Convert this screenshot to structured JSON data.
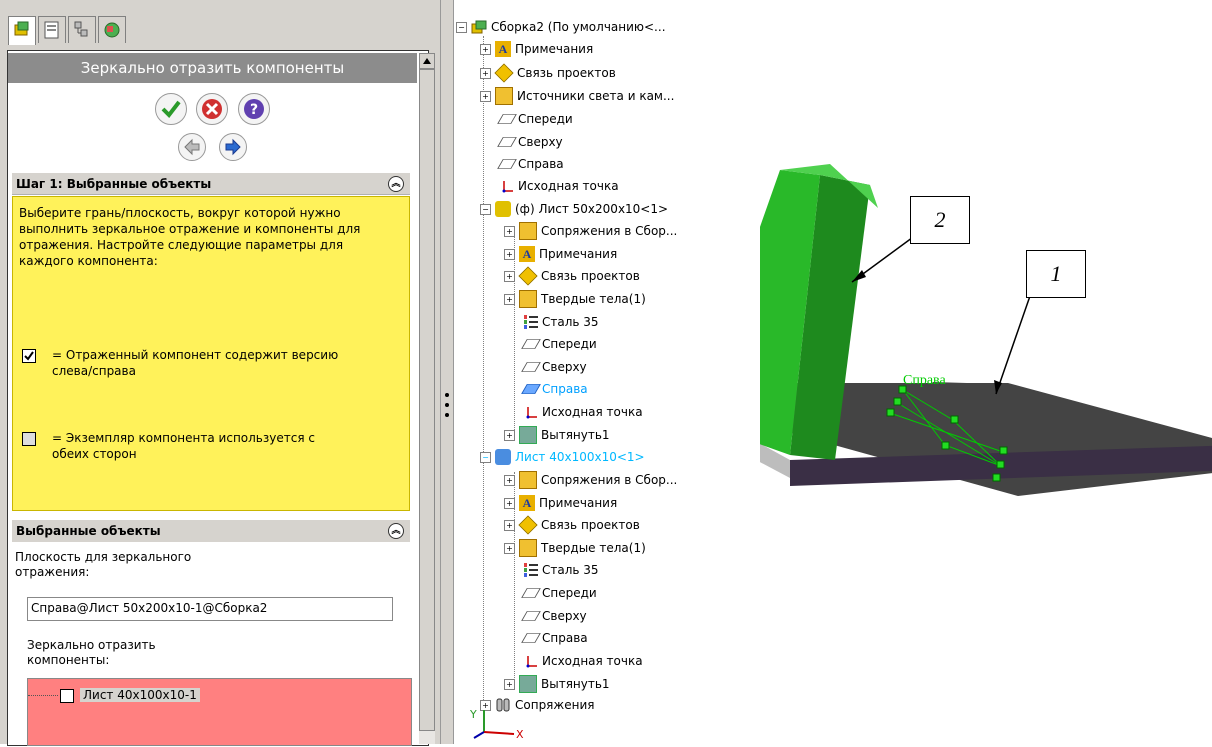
{
  "left_panel": {
    "title": "Зеркально отразить компоненты",
    "step1": {
      "header": "Шаг 1: Выбранные объекты",
      "description": "Выберите грань/плоскость, вокруг которой нужно выполнить зеркальное отражение и компоненты для отражения. Настройте следующие параметры для каждого компонента:",
      "legend_checked": "= Отраженный компонент содержит версию слева/справа",
      "legend_unchecked": "= Экземпляр компонента используется с обеих сторон"
    },
    "selections": {
      "header": "Выбранные объекты",
      "plane_label": "Плоскость для зеркального отражения:",
      "plane_value": "Справа@Лист 50х200х10-1@Сборка2",
      "components_label": "Зеркально отразить компоненты:",
      "components": [
        "Лист 40х100х10-1"
      ]
    },
    "colors": {
      "yellow": "#fff25a",
      "pink": "#ff8080"
    }
  },
  "tree": {
    "root": "Сборка2  (По умолчанию<...",
    "items": [
      "Примечания",
      "Связь проектов",
      "Источники света и кам...",
      "Спереди",
      "Сверху",
      "Справа",
      "Исходная точка",
      "(ф) Лист 50х200х10<1>",
      "Сопряжения в Сбор...",
      "Примечания",
      "Связь проектов",
      "Твердые тела(1)",
      "Сталь 35",
      "Спереди",
      "Сверху",
      "Справа",
      "Исходная точка",
      "Вытянуть1",
      "Лист 40х100х10<1>",
      "Сопряжения в Сбор...",
      "Примечания",
      "Связь проектов",
      "Твердые тела(1)",
      "Сталь 35",
      "Спереди",
      "Сверху",
      "Справа",
      "Исходная точка",
      "Вытянуть1",
      "Сопряжения"
    ]
  },
  "view": {
    "plane_label": "Справа",
    "callout_1": "1",
    "callout_2": "2",
    "axis_y": "Y",
    "axis_x": "X"
  }
}
